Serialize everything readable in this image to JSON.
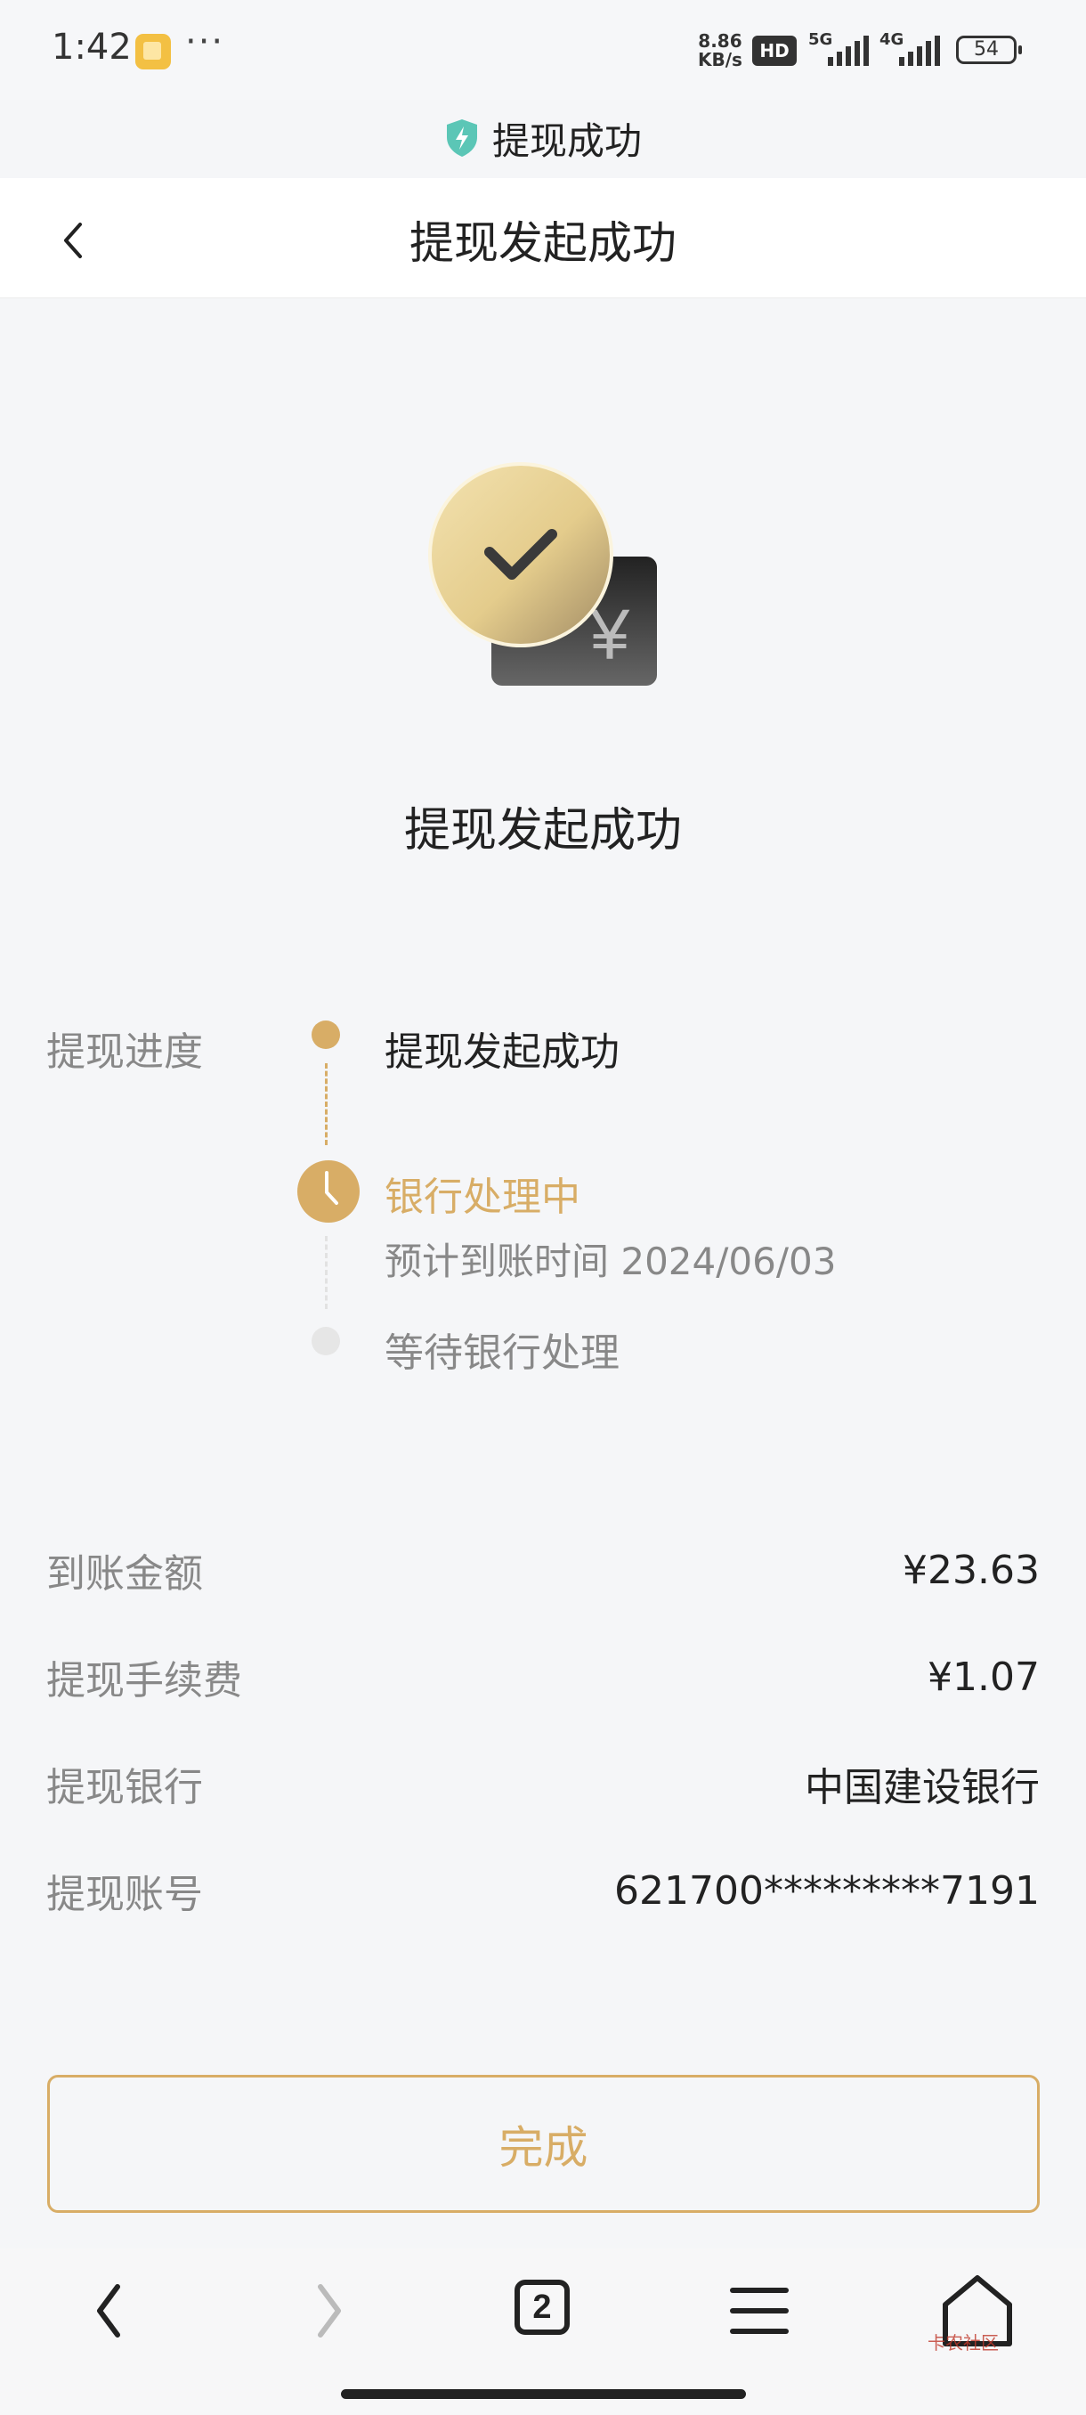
{
  "status_bar": {
    "time": "1:42",
    "dots": "···",
    "net_speed_value": "8.86",
    "net_speed_unit": "KB/s",
    "hd": "HD",
    "sig1_label": "5G",
    "sig2_label": "4G",
    "battery": "54"
  },
  "secure_bar": {
    "title": "提现成功",
    "icon": "shield-bolt-icon"
  },
  "header": {
    "title": "提现发起成功",
    "back_icon": "chevron-left-icon"
  },
  "hero": {
    "title": "提现发起成功",
    "icon": "check-coin-icon"
  },
  "progress": {
    "label": "提现进度",
    "steps": [
      {
        "label": "提现发起成功",
        "status": "done"
      },
      {
        "label": "银行处理中",
        "status": "current",
        "sub": "预计到账时间 2024/06/03"
      },
      {
        "label": "等待银行处理",
        "status": "pending"
      }
    ]
  },
  "details": [
    {
      "label": "到账金额",
      "value": "¥23.63"
    },
    {
      "label": "提现手续费",
      "value": "¥1.07"
    },
    {
      "label": "提现银行",
      "value": "中国建设银行"
    },
    {
      "label": "提现账号",
      "value": "621700*********7191"
    }
  ],
  "done_button": {
    "label": "完成"
  },
  "browser_nav": {
    "tab_count": "2"
  },
  "watermark": "卡农社区",
  "colors": {
    "accent": "#d8ad66",
    "background": "#f5f6f8",
    "muted": "#888888"
  }
}
